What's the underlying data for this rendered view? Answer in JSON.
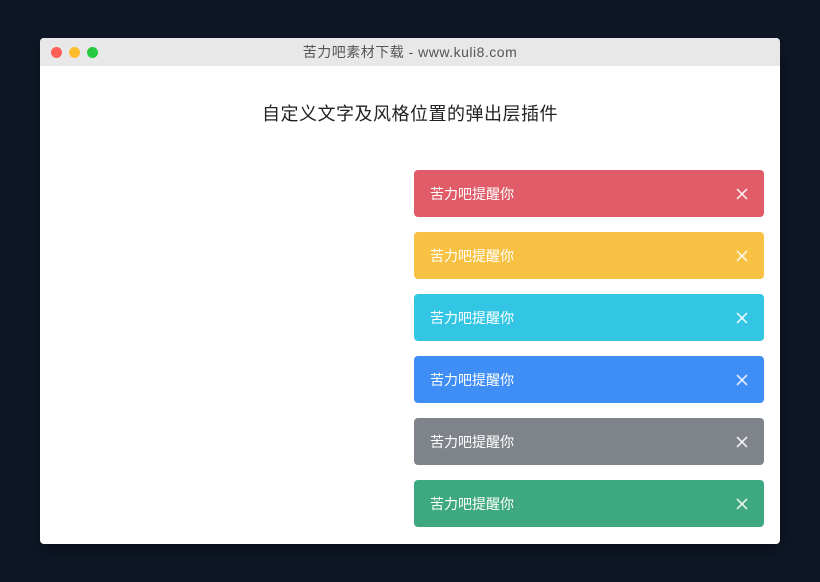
{
  "titlebar": {
    "title": "苦力吧素材下载 - www.kuli8.com"
  },
  "heading": "自定义文字及风格位置的弹出层插件",
  "toasts": [
    {
      "label": "苦力吧提醒你",
      "colorClass": "toast-red"
    },
    {
      "label": "苦力吧提醒你",
      "colorClass": "toast-yellow"
    },
    {
      "label": "苦力吧提醒你",
      "colorClass": "toast-cyan"
    },
    {
      "label": "苦力吧提醒你",
      "colorClass": "toast-blue"
    },
    {
      "label": "苦力吧提醒你",
      "colorClass": "toast-gray"
    },
    {
      "label": "苦力吧提醒你",
      "colorClass": "toast-green"
    }
  ]
}
